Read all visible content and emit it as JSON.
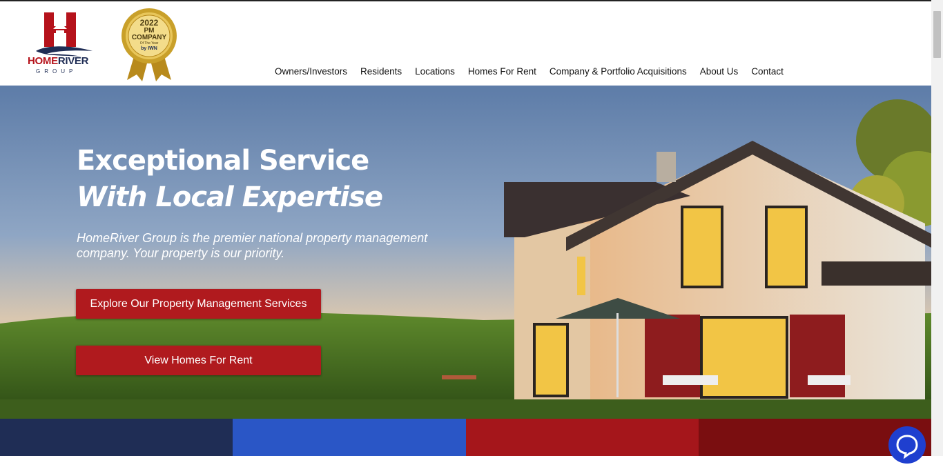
{
  "brand": {
    "logo_word_home": "HOME",
    "logo_word_river": "RIVER",
    "logo_sub": "GROUP",
    "badge_year": "2022",
    "badge_line1": "PM",
    "badge_line2": "COMPANY",
    "badge_line3": "Of The Year",
    "badge_line4": "by IWN"
  },
  "nav": {
    "items": [
      {
        "label": "Owners/Investors"
      },
      {
        "label": "Residents"
      },
      {
        "label": "Locations"
      },
      {
        "label": "Homes For Rent"
      },
      {
        "label": "Company & Portfolio Acquisitions"
      },
      {
        "label": "About Us"
      },
      {
        "label": "Contact"
      }
    ]
  },
  "hero": {
    "headline": "Exceptional Service",
    "headline_italic": "With Local Expertise",
    "description": "HomeRiver Group is the premier national property management company. Your property is our priority.",
    "cta_primary": "Explore Our Property Management Services",
    "cta_secondary": "View Homes For Rent"
  },
  "colors": {
    "brand_red": "#b01a1e",
    "band_1": "#1f2d55",
    "band_2": "#2a56c6",
    "band_3": "#a5161b",
    "band_4": "#7a0e10",
    "chat": "#1f3fcf"
  },
  "icons": {
    "chat": "chat-bubble-icon"
  }
}
